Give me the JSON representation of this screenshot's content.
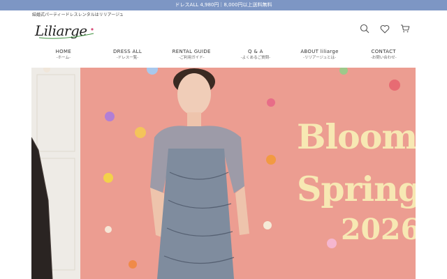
{
  "announcement": "ドレスALL 4,980円｜8,000円以上送料無料",
  "tagline": "結婚式パーティードレスレンタルはリリアージュ",
  "logo": "Liliarge",
  "header_icons": [
    "search-icon",
    "heart-icon",
    "cart-icon"
  ],
  "nav": [
    {
      "label": "HOME",
      "sub": "-ホーム-"
    },
    {
      "label": "DRESS ALL",
      "sub": "-ドレス一覧-"
    },
    {
      "label": "RENTAL GUIDE",
      "sub": "-ご利用ガイド-"
    },
    {
      "label": "Q & A",
      "sub": "-よくあるご質問-"
    },
    {
      "label": "ABOUT liliarge",
      "sub": "-リリアージュとは-"
    },
    {
      "label": "CONTACT",
      "sub": "-お問い合わせ-"
    }
  ],
  "hero": {
    "line1": "Bloom",
    "line2": "Spring",
    "line3": "2026"
  },
  "colors": {
    "announcement_bg": "#7d96c4",
    "hero_bg": "#ec9d91",
    "hero_text": "#f7e8b3"
  }
}
